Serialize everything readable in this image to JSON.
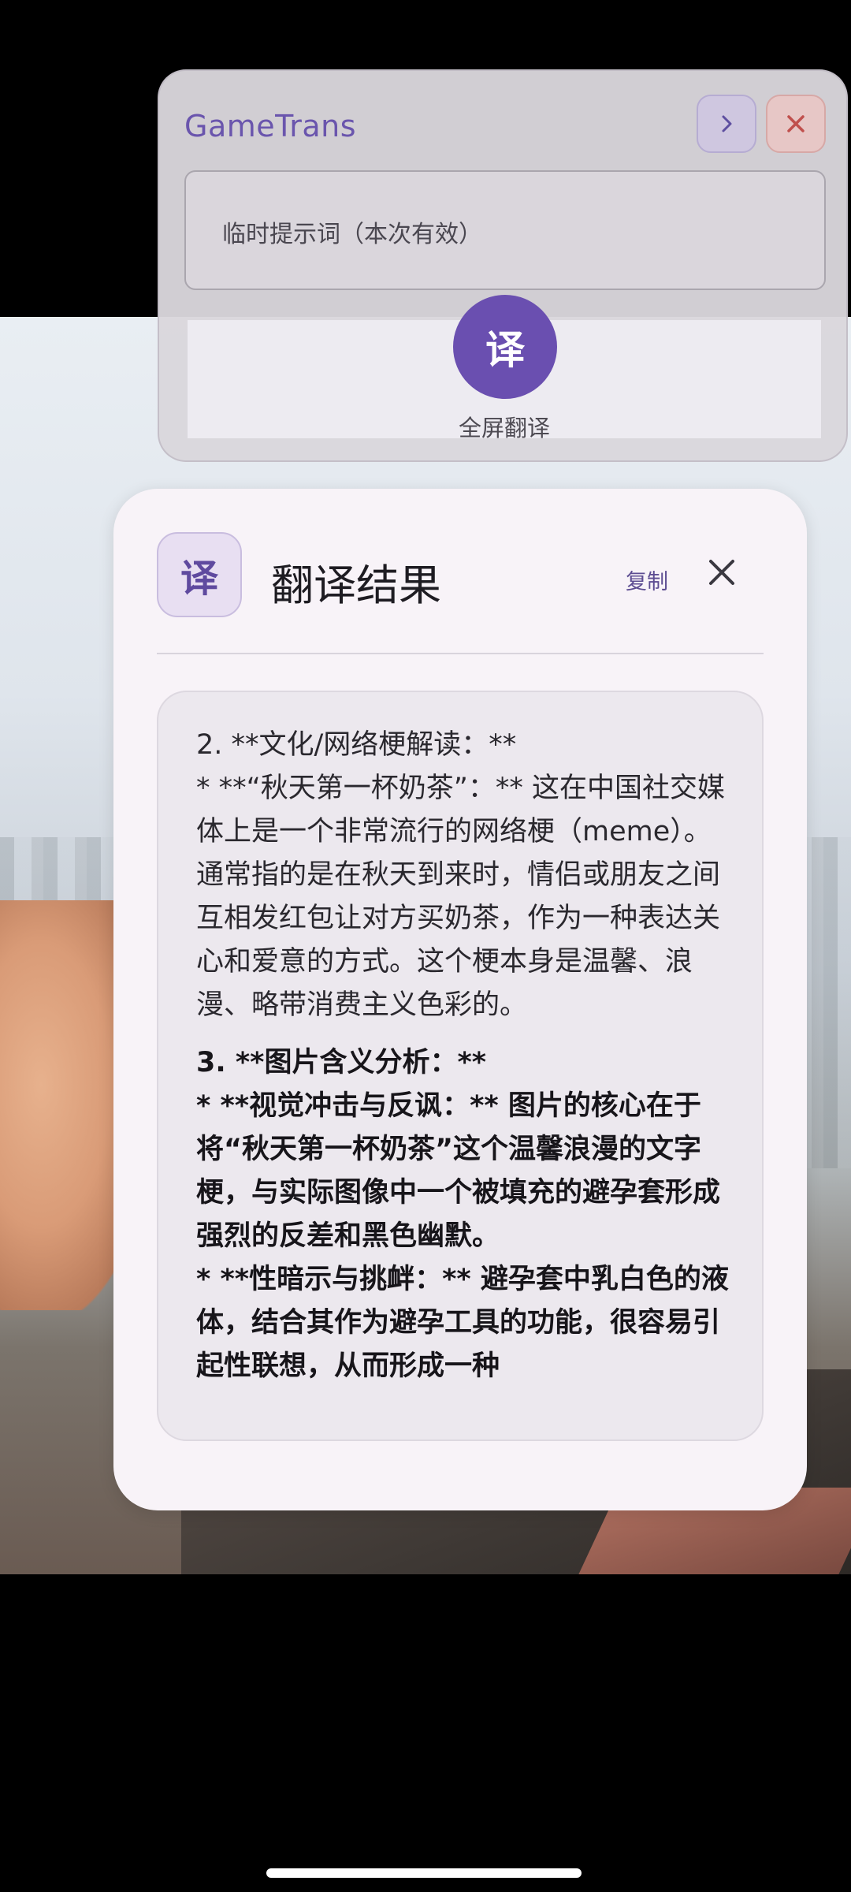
{
  "floating_panel": {
    "app_name": "GameTrans",
    "prompt_placeholder": "临时提示词（本次有效）",
    "translate_button_glyph": "译",
    "translate_button_label": "全屏翻译",
    "next_icon": "chevron-right-icon",
    "close_icon": "close-icon",
    "colors": {
      "accent": "#6a4fb0",
      "close": "#c0504d"
    }
  },
  "result_card": {
    "icon_glyph": "译",
    "title": "翻译结果",
    "copy_label": "复制",
    "close_icon": "close-icon",
    "paragraphs": [
      "2. **文化/网络梗解读：**",
      "*    **“秋天第一杯奶茶”：** 这在中国社交媒体上是一个非常流行的网络梗（meme）。通常指的是在秋天到来时，情侣或朋友之间互相发红包让对方买奶茶，作为一种表达关心和爱意的方式。这个梗本身是温馨、浪漫、略带消费主义色彩的。",
      "3. **图片含义分析：**",
      "*    **视觉冲击与反讽：** 图片的核心在于将“秋天第一杯奶茶”这个温馨浪漫的文字梗，与实际图像中一个被填充的避孕套形成强烈的反差和黑色幽默。",
      "*    **性暗示与挑衅：** 避孕套中乳白色的液体，结合其作为避孕工具的功能，很容易引起性联想，从而形成一种"
    ]
  }
}
